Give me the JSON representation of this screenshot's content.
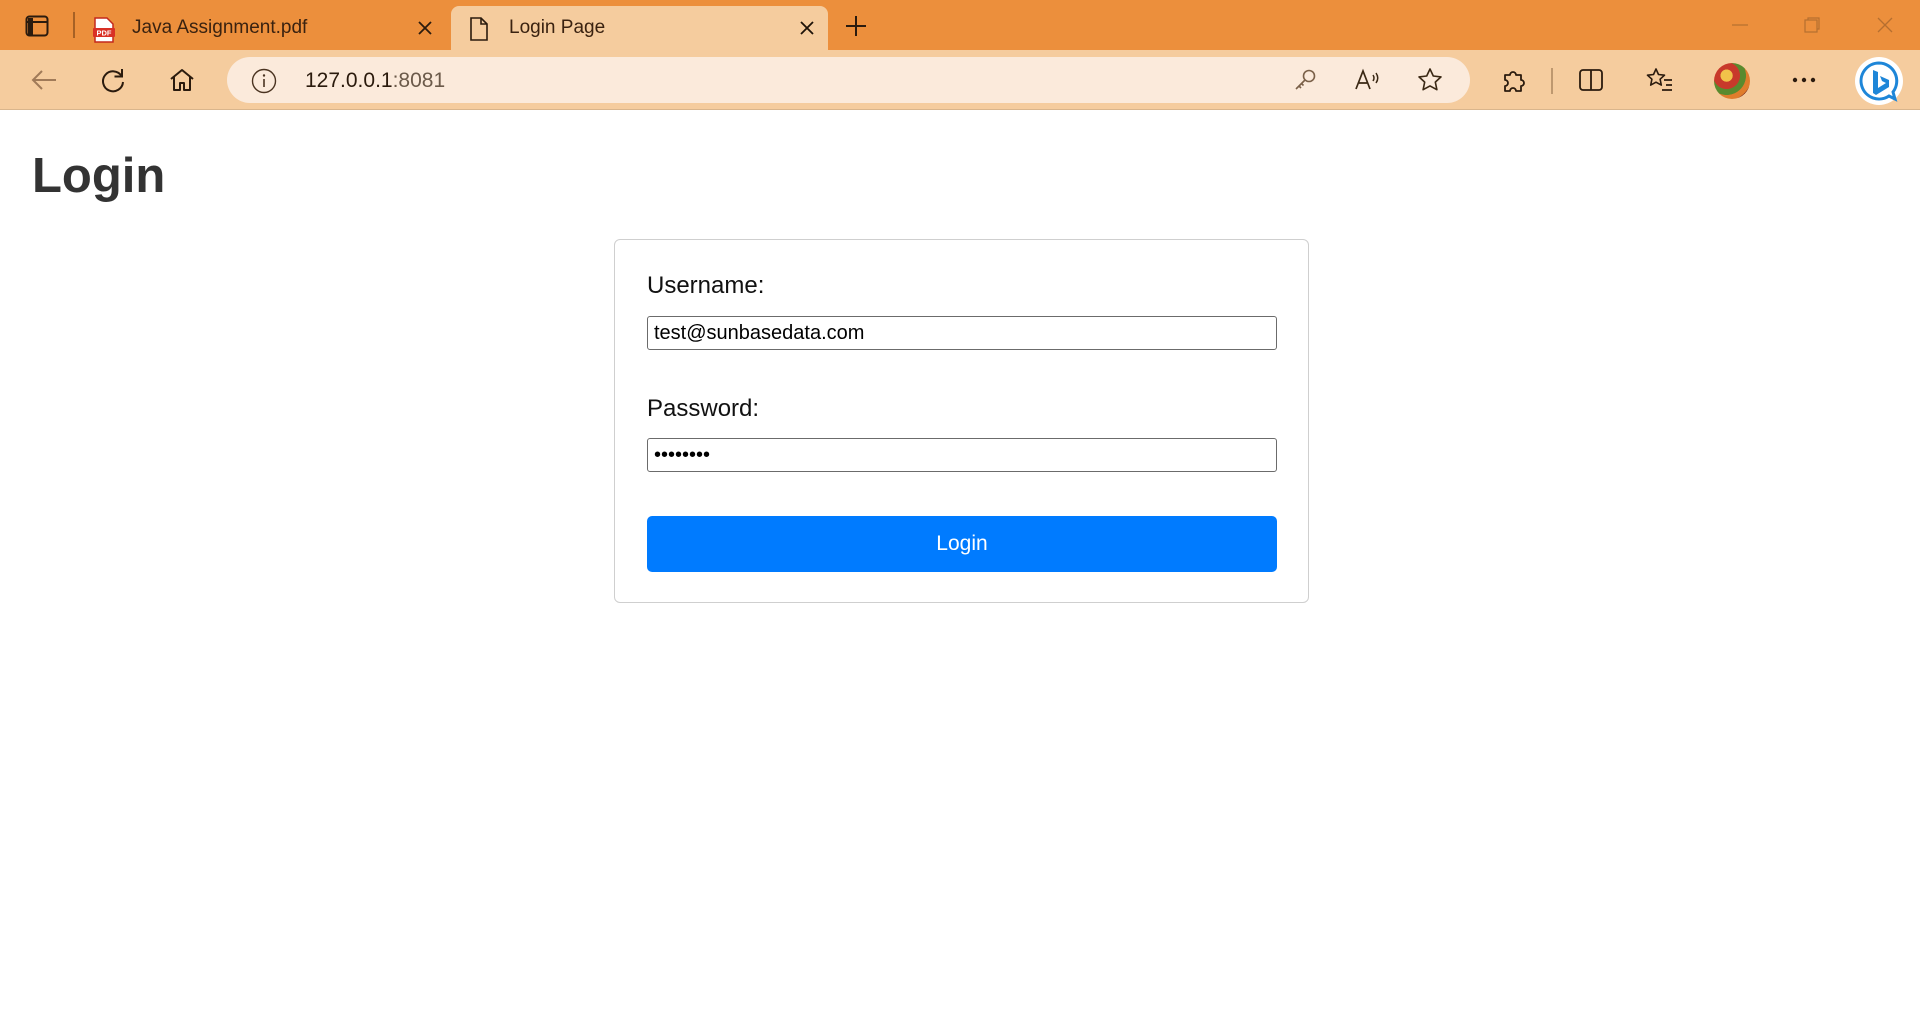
{
  "browser": {
    "tabs": [
      {
        "title": "Java Assignment.pdf",
        "icon": "pdf-icon",
        "active": false
      },
      {
        "title": "Login Page",
        "icon": "page-icon",
        "active": true
      }
    ],
    "pdf_badge": "PDF",
    "address": {
      "host": "127.0.0.1",
      "port": ":8081"
    },
    "colors": {
      "tabstrip": "#ec8f3c",
      "toolbar": "#f5cc9e",
      "accent": "#007bff"
    }
  },
  "page": {
    "title": "Login",
    "form": {
      "username_label": "Username:",
      "username_value": "test@sunbasedata.com",
      "password_label": "Password:",
      "password_value": "password",
      "submit_label": "Login"
    }
  }
}
